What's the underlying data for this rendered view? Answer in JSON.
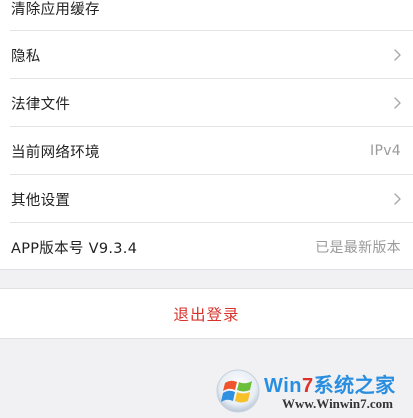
{
  "settings": {
    "items": [
      {
        "label": "清除应用缓存"
      },
      {
        "label": "隐私"
      },
      {
        "label": "法律文件"
      },
      {
        "label": "当前网络环境",
        "value": "IPv4"
      },
      {
        "label": "其他设置"
      },
      {
        "label": "APP版本号 V9.3.4",
        "value": "已是最新版本"
      }
    ]
  },
  "logout": {
    "label": "退出登录"
  },
  "watermark": {
    "title_prefix": "Win",
    "title_seven": "7",
    "title_suffix": "系统之家",
    "url": "Www.Winwin7.com"
  },
  "colors": {
    "background": "#f1f1f3",
    "logout_text": "#d9322b",
    "value_text": "#9a9a9a",
    "label_text": "#222222"
  },
  "icons": {
    "row_chevron": "chevron-right-icon",
    "watermark_logo": "windows-logo-icon"
  }
}
